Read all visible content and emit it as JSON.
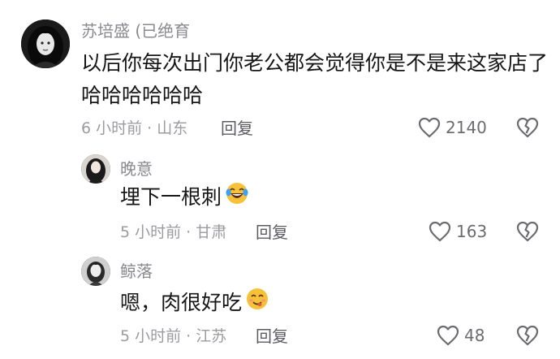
{
  "comments": [
    {
      "username": "苏培盛 (已绝育",
      "text_line1": "以后你每次出门你老公都会觉得你是不是来这家店了",
      "text_line2": "哈哈哈哈哈哈",
      "time_location": "6 小时前 · 山东",
      "reply_label": "回复",
      "like_count": "2140",
      "avatar_icon": "avatar-dark-hair-icon"
    },
    {
      "username": "晚意",
      "text": "埋下一根刺",
      "emoji": "laughing-tears-emoji",
      "time_location": "5 小时前 · 甘肃",
      "reply_label": "回复",
      "like_count": "163",
      "avatar_icon": "avatar-woman-icon"
    },
    {
      "username": "鲸落",
      "text": "嗯，肉很好吃",
      "emoji": "yummy-face-emoji",
      "time_location": "5 小时前 · 江苏",
      "reply_label": "回复",
      "like_count": "48",
      "avatar_icon": "avatar-girl-icon"
    }
  ],
  "colors": {
    "username": "#8a8a8f",
    "content": "#161616",
    "meta": "#9b9ba0",
    "reply": "#5c5c60",
    "icon": "#6b6b70",
    "emoji_yellow": "#f7c23a"
  }
}
